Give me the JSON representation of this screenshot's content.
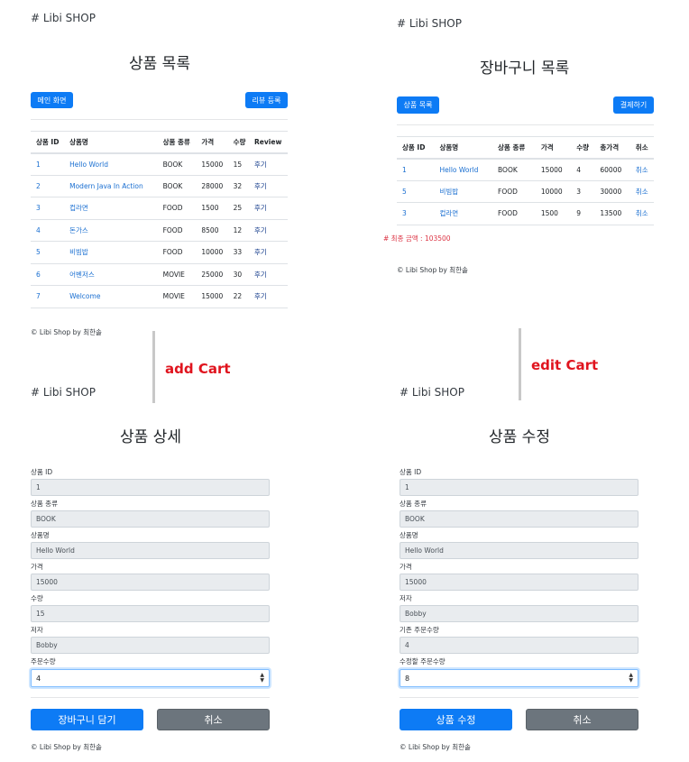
{
  "list_page": {
    "brand": "# Libi SHOP",
    "title": "상품 목록",
    "main_button": "메인 화면",
    "review_button": "리뷰 등록",
    "columns": [
      "상품 ID",
      "상품명",
      "상품 종류",
      "가격",
      "수량",
      "Review"
    ],
    "rows": [
      [
        "1",
        "Hello World",
        "BOOK",
        "15000",
        "15",
        "후기"
      ],
      [
        "2",
        "Modern Java In Action",
        "BOOK",
        "28000",
        "32",
        "후기"
      ],
      [
        "3",
        "컵라면",
        "FOOD",
        "1500",
        "25",
        "후기"
      ],
      [
        "4",
        "돈가스",
        "FOOD",
        "8500",
        "12",
        "후기"
      ],
      [
        "5",
        "비빔밥",
        "FOOD",
        "10000",
        "33",
        "후기"
      ],
      [
        "6",
        "어벤저스",
        "MOVIE",
        "25000",
        "30",
        "후기"
      ],
      [
        "7",
        "Welcome",
        "MOVIE",
        "15000",
        "22",
        "후기"
      ]
    ],
    "footer": "© Libi Shop by 최한솔"
  },
  "cart_page": {
    "brand": "# Libi SHOP",
    "title": "장바구니 목록",
    "list_button": "상품 목록",
    "pay_button": "결제하기",
    "columns": [
      "상품 ID",
      "상품명",
      "상품 종류",
      "가격",
      "수량",
      "총가격",
      "취소"
    ],
    "rows": [
      [
        "1",
        "Hello World",
        "BOOK",
        "15000",
        "4",
        "60000",
        "취소"
      ],
      [
        "5",
        "비빔밥",
        "FOOD",
        "10000",
        "3",
        "30000",
        "취소"
      ],
      [
        "3",
        "컵라면",
        "FOOD",
        "1500",
        "9",
        "13500",
        "취소"
      ]
    ],
    "total": "# 최종 금액 : 103500",
    "footer": "© Libi Shop by 최한솔"
  },
  "annotations": {
    "add_cart": "add Cart",
    "edit_cart": "edit Cart"
  },
  "detail_page": {
    "brand": "# Libi SHOP",
    "title": "상품 상세",
    "fields": [
      {
        "label": "상품 ID",
        "value": "1"
      },
      {
        "label": "상품 종류",
        "value": "BOOK"
      },
      {
        "label": "상품명",
        "value": "Hello World"
      },
      {
        "label": "가격",
        "value": "15000"
      },
      {
        "label": "수량",
        "value": "15"
      },
      {
        "label": "저자",
        "value": "Bobby"
      }
    ],
    "order_label": "주문수량",
    "order_value": "4",
    "submit_button": "장바구니 담기",
    "cancel_button": "취소",
    "footer": "© Libi Shop by 최한솔"
  },
  "edit_page": {
    "brand": "# Libi SHOP",
    "title": "상품 수정",
    "fields": [
      {
        "label": "상품 ID",
        "value": "1"
      },
      {
        "label": "상품 종류",
        "value": "BOOK"
      },
      {
        "label": "상품명",
        "value": "Hello World"
      },
      {
        "label": "가격",
        "value": "15000"
      },
      {
        "label": "저자",
        "value": "Bobby"
      },
      {
        "label": "기존 주문수량",
        "value": "4"
      }
    ],
    "order_label": "수정할 주문수량",
    "order_value": "8",
    "submit_button": "상품 수정",
    "cancel_button": "취소",
    "footer": "© Libi Shop by 최한솔"
  },
  "colors": {
    "primary": "#0d7bf5",
    "secondary": "#6c757d",
    "link": "#1a6fd1",
    "danger": "#dc3545",
    "annotation": "#e0141e"
  }
}
